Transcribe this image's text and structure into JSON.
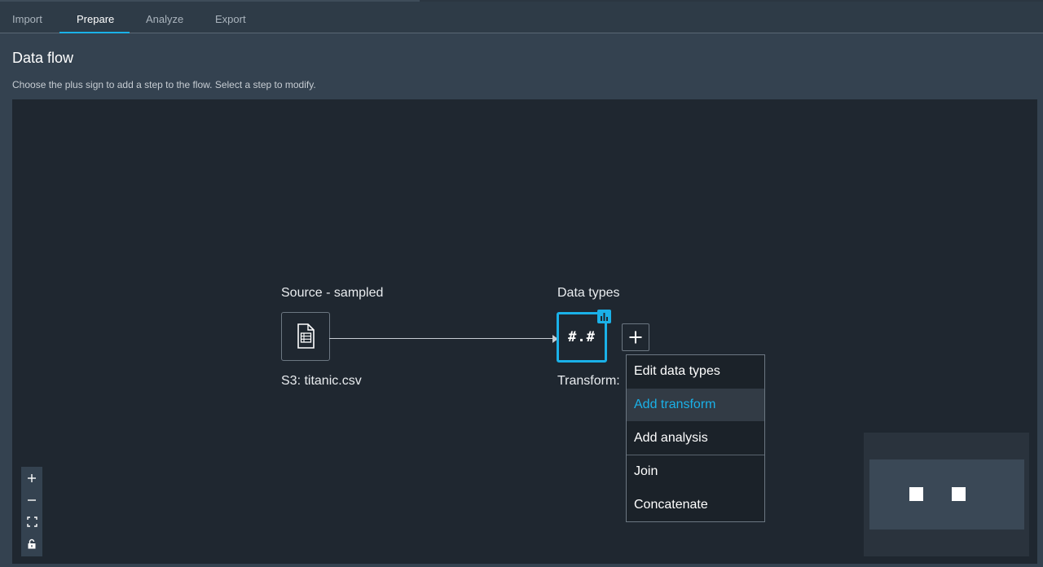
{
  "tabs": [
    {
      "label": "Import",
      "active": false
    },
    {
      "label": "Prepare",
      "active": true
    },
    {
      "label": "Analyze",
      "active": false
    },
    {
      "label": "Export",
      "active": false
    }
  ],
  "page": {
    "title": "Data flow",
    "description": "Choose the plus sign to add a step to the flow. Select a step to modify."
  },
  "flow": {
    "source": {
      "title": "Source - sampled",
      "subtitle": "S3: titanic.csv",
      "icon": "csv-file-icon"
    },
    "datatypes": {
      "title": "Data types",
      "glyph": "#.#",
      "subtitle": "Transform:",
      "icon": "data-types-icon",
      "badge_icon": "bar-chart-icon"
    },
    "add_step_icon": "plus-icon"
  },
  "context_menu": {
    "items": [
      {
        "label": "Edit data types"
      },
      {
        "label": "Add transform",
        "highlighted": true
      },
      {
        "label": "Add analysis"
      },
      {
        "label": "Join"
      },
      {
        "label": "Concatenate"
      }
    ]
  },
  "zoom_controls": [
    "zoom-in-icon",
    "zoom-out-icon",
    "fit-view-icon",
    "lock-icon"
  ],
  "colors": {
    "accent": "#1ab1e8",
    "background": "#344250",
    "canvas": "#1f2730",
    "menu": "#1b2229"
  }
}
